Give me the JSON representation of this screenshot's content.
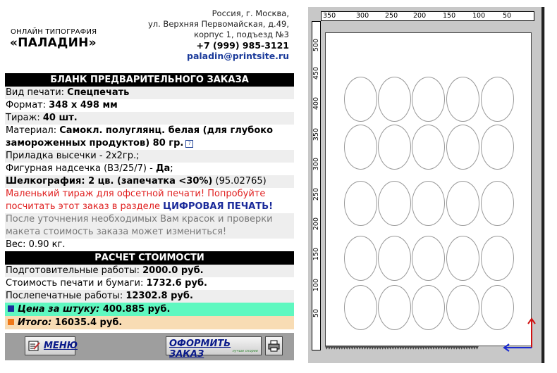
{
  "brand": {
    "subtitle": "ОНЛАЙН ТИПОГРАФИЯ",
    "name": "«ПАЛАДИН»"
  },
  "contact": {
    "address1": "Россия, г. Москва,",
    "address2": "ул. Верхняя Первомайская, д.49,",
    "address3": "корпус 1, подъезд №3",
    "phone": "+7 (999) 985-3121",
    "email": "paladin@printsite.ru"
  },
  "order": {
    "header": "БЛАНК ПРЕДВАРИТЕЛЬНОГО ЗАКАЗА",
    "print_type_label": "Вид печати: ",
    "print_type_value": "Спецпечать",
    "format_label": "Формат: ",
    "format_value": "348 х 498 мм",
    "run_label": "Тираж: ",
    "run_value": "40 шт.",
    "material_label": "Материал: ",
    "material_value": "Самокл. полуглянц. белая (для глубоко замороженных продуктов) 80 гр.",
    "help_glyph": "?",
    "die_label": "Приладка высечки - 2х2гр.;",
    "cut_label": "Фигурная надсечка (В3/25/7) - ",
    "cut_value": "Да",
    "silk_value": "Шелкография: 2 цв. (запечатка <30%)",
    "silk_code": " (95.02765)",
    "warning": "Маленький тираж для офсетной печати! Попробуйте посчитать этот заказ в разделе ",
    "warning_link": "ЦИФРОВАЯ ПЕЧАТЬ!",
    "note": "После уточнения необходимых Вам красок и проверки макета стоимость заказа может измениться!",
    "weight_label": "Вес: 0.90 кг."
  },
  "cost": {
    "header": "РАСЧЕТ СТОИМОСТИ",
    "prep_label": "Подготовительные работы: ",
    "prep_value": "2000.0 руб.",
    "print_label": "Стоимость печати и бумаги: ",
    "print_value": "1732.6 руб.",
    "post_label": "Послепечатные работы: ",
    "post_value": "12302.8 руб.",
    "unit_label": "Цена за штуку: ",
    "unit_value": "400.885 руб.",
    "total_label": "Итого: ",
    "total_value": "16035.4 руб."
  },
  "buttons": {
    "menu": "МЕНЮ",
    "order": "ОФОРМИТЬ ЗАКАЗ",
    "order_sub": "лучше скорее"
  },
  "ruler": {
    "top": [
      "350",
      "300",
      "250",
      "200",
      "150",
      "100",
      "50"
    ],
    "left": [
      "500",
      "450",
      "400",
      "350",
      "300",
      "250",
      "200",
      "150",
      "100",
      "50"
    ]
  },
  "colors": {
    "price_bg": "#5ff8c0",
    "total_bg": "#f8dcb4",
    "link": "#1a2a9a",
    "warning": "#e02020"
  }
}
